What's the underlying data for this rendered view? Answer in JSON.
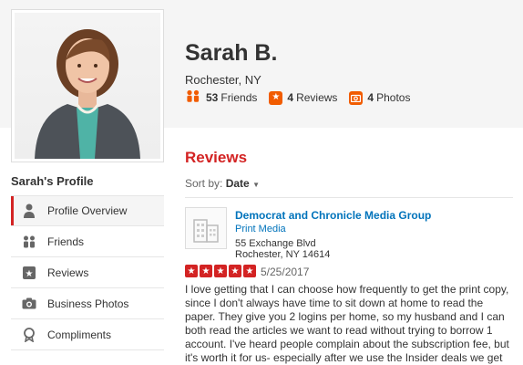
{
  "profile": {
    "name": "Sarah B.",
    "location": "Rochester, NY",
    "stats": {
      "friends_count": "53",
      "friends_label": "Friends",
      "reviews_count": "4",
      "reviews_label": "Reviews",
      "photos_count": "4",
      "photos_label": "Photos"
    }
  },
  "sidebar": {
    "title": "Sarah's Profile",
    "items": [
      {
        "label": "Profile Overview",
        "icon": "person-icon"
      },
      {
        "label": "Friends",
        "icon": "friends-icon"
      },
      {
        "label": "Reviews",
        "icon": "star-icon"
      },
      {
        "label": "Business Photos",
        "icon": "camera-icon"
      },
      {
        "label": "Compliments",
        "icon": "compliment-icon"
      }
    ]
  },
  "reviews": {
    "title": "Reviews",
    "sort_prefix": "Sort by:",
    "sort_value": "Date",
    "items": [
      {
        "business_name": "Democrat and Chronicle Media Group",
        "category": "Print Media",
        "address_line1": "55 Exchange Blvd",
        "address_line2": "Rochester, NY 14614",
        "rating": 5,
        "date": "5/25/2017",
        "text": "I love getting that I can choose how frequently to get the print copy, since I don't always have time to sit down at home to read the paper. They give you 2 logins per home, so my husband and I can both read the articles we want to read without trying to borrow 1 account. I've heard people complain about the subscription fee, but it's worth it for us- especially after we use the Insider deals we get for being subscribers. Works for us!"
      }
    ]
  },
  "colors": {
    "accent_red": "#d32323",
    "link_blue": "#0073bb",
    "stat_orange": "#f15c00"
  }
}
